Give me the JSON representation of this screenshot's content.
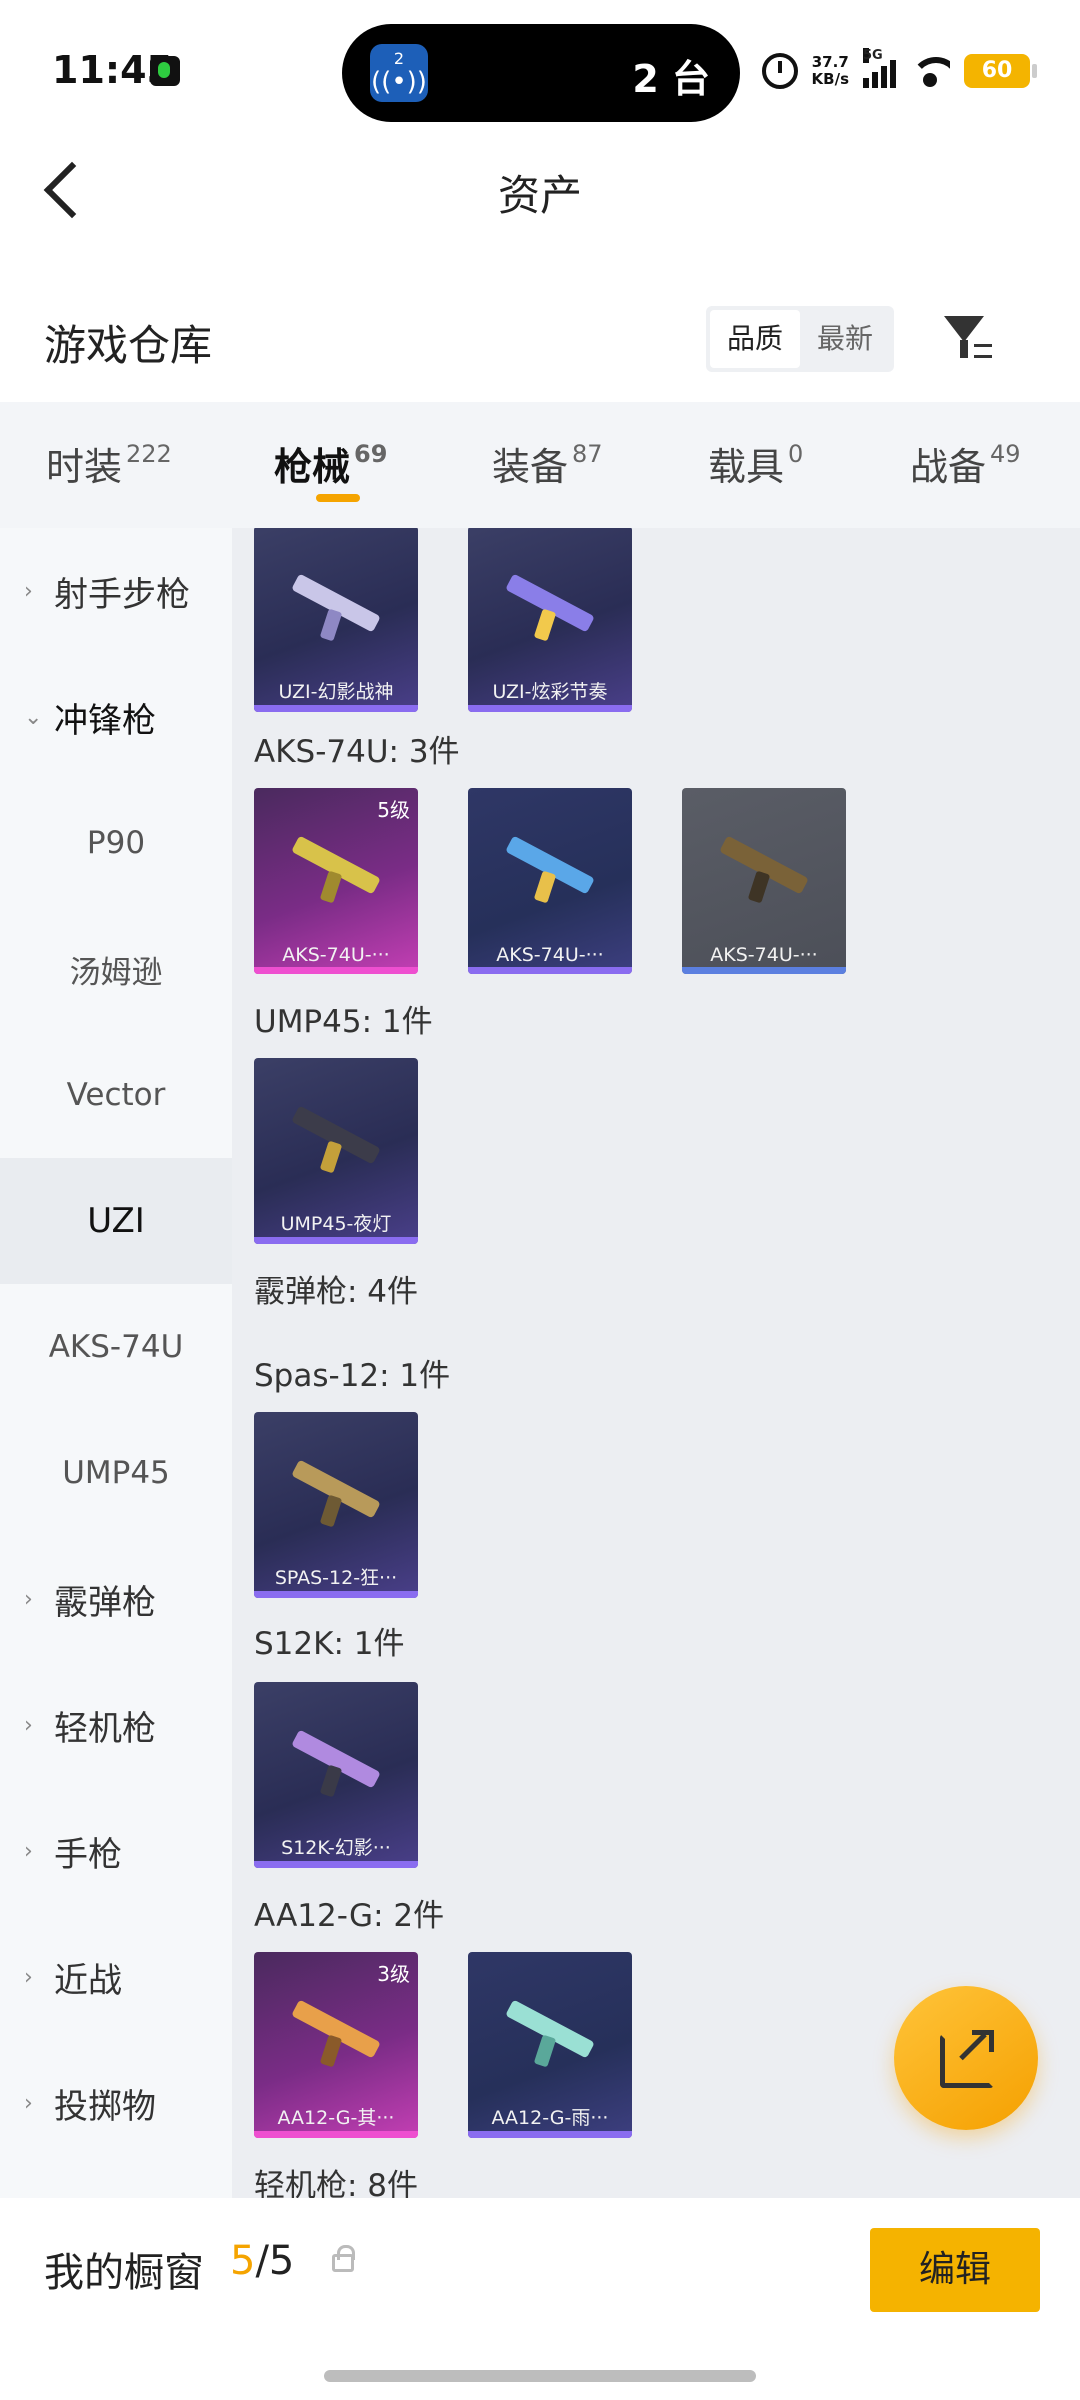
{
  "status": {
    "time": "11:45",
    "island_text": "2 台",
    "island_icon_num": "2",
    "speed_value": "37.7",
    "speed_unit": "KB/s",
    "network": "5G",
    "battery": "60"
  },
  "header": {
    "title": "资产"
  },
  "warehouse": {
    "title": "游戏仓库",
    "sort_quality": "品质",
    "sort_newest": "最新"
  },
  "tabs": [
    {
      "label": "时装",
      "count": "222"
    },
    {
      "label": "枪械",
      "count": "69"
    },
    {
      "label": "装备",
      "count": "87"
    },
    {
      "label": "载具",
      "count": "0"
    },
    {
      "label": "战备",
      "count": "49"
    }
  ],
  "sidebar": {
    "items": [
      {
        "label": "射手步枪",
        "chevron": "›"
      },
      {
        "label": "冲锋枪",
        "chevron": "⌄"
      },
      {
        "label": "P90"
      },
      {
        "label": "汤姆逊"
      },
      {
        "label": "Vector"
      },
      {
        "label": "UZI"
      },
      {
        "label": "AKS-74U"
      },
      {
        "label": "UMP45"
      },
      {
        "label": "霰弹枪",
        "chevron": "›"
      },
      {
        "label": "轻机枪",
        "chevron": "›"
      },
      {
        "label": "手枪",
        "chevron": "›"
      },
      {
        "label": "近战",
        "chevron": "›"
      },
      {
        "label": "投掷物",
        "chevron": "›"
      }
    ]
  },
  "content": {
    "sections": [
      {
        "label": "AKS-74U: 3件"
      },
      {
        "label": "UMP45: 1件"
      },
      {
        "label": "霰弹枪: 4件"
      },
      {
        "label": "Spas-12: 1件"
      },
      {
        "label": "S12K: 1件"
      },
      {
        "label": "AA12-G: 2件"
      },
      {
        "label": "轻机枪: 8件"
      }
    ],
    "cards": [
      {
        "label": "UZI-幻影战神",
        "level": ""
      },
      {
        "label": "UZI-炫彩节奏",
        "level": ""
      },
      {
        "label": "AKS-74U-···",
        "level": "5级"
      },
      {
        "label": "AKS-74U-···",
        "level": ""
      },
      {
        "label": "AKS-74U-···",
        "level": ""
      },
      {
        "label": "UMP45-夜灯",
        "level": ""
      },
      {
        "label": "SPAS-12-狂···",
        "level": ""
      },
      {
        "label": "S12K-幻影···",
        "level": ""
      },
      {
        "label": "AA12-G-其···",
        "level": "3级"
      },
      {
        "label": "AA12-G-雨···",
        "level": ""
      }
    ]
  },
  "bottom": {
    "showcase_title": "我的橱窗",
    "count_current": "5",
    "count_total": "/5",
    "edit_label": "编辑"
  },
  "colors": {
    "accent": "#f5a400",
    "edit_button": "#f5b300"
  }
}
